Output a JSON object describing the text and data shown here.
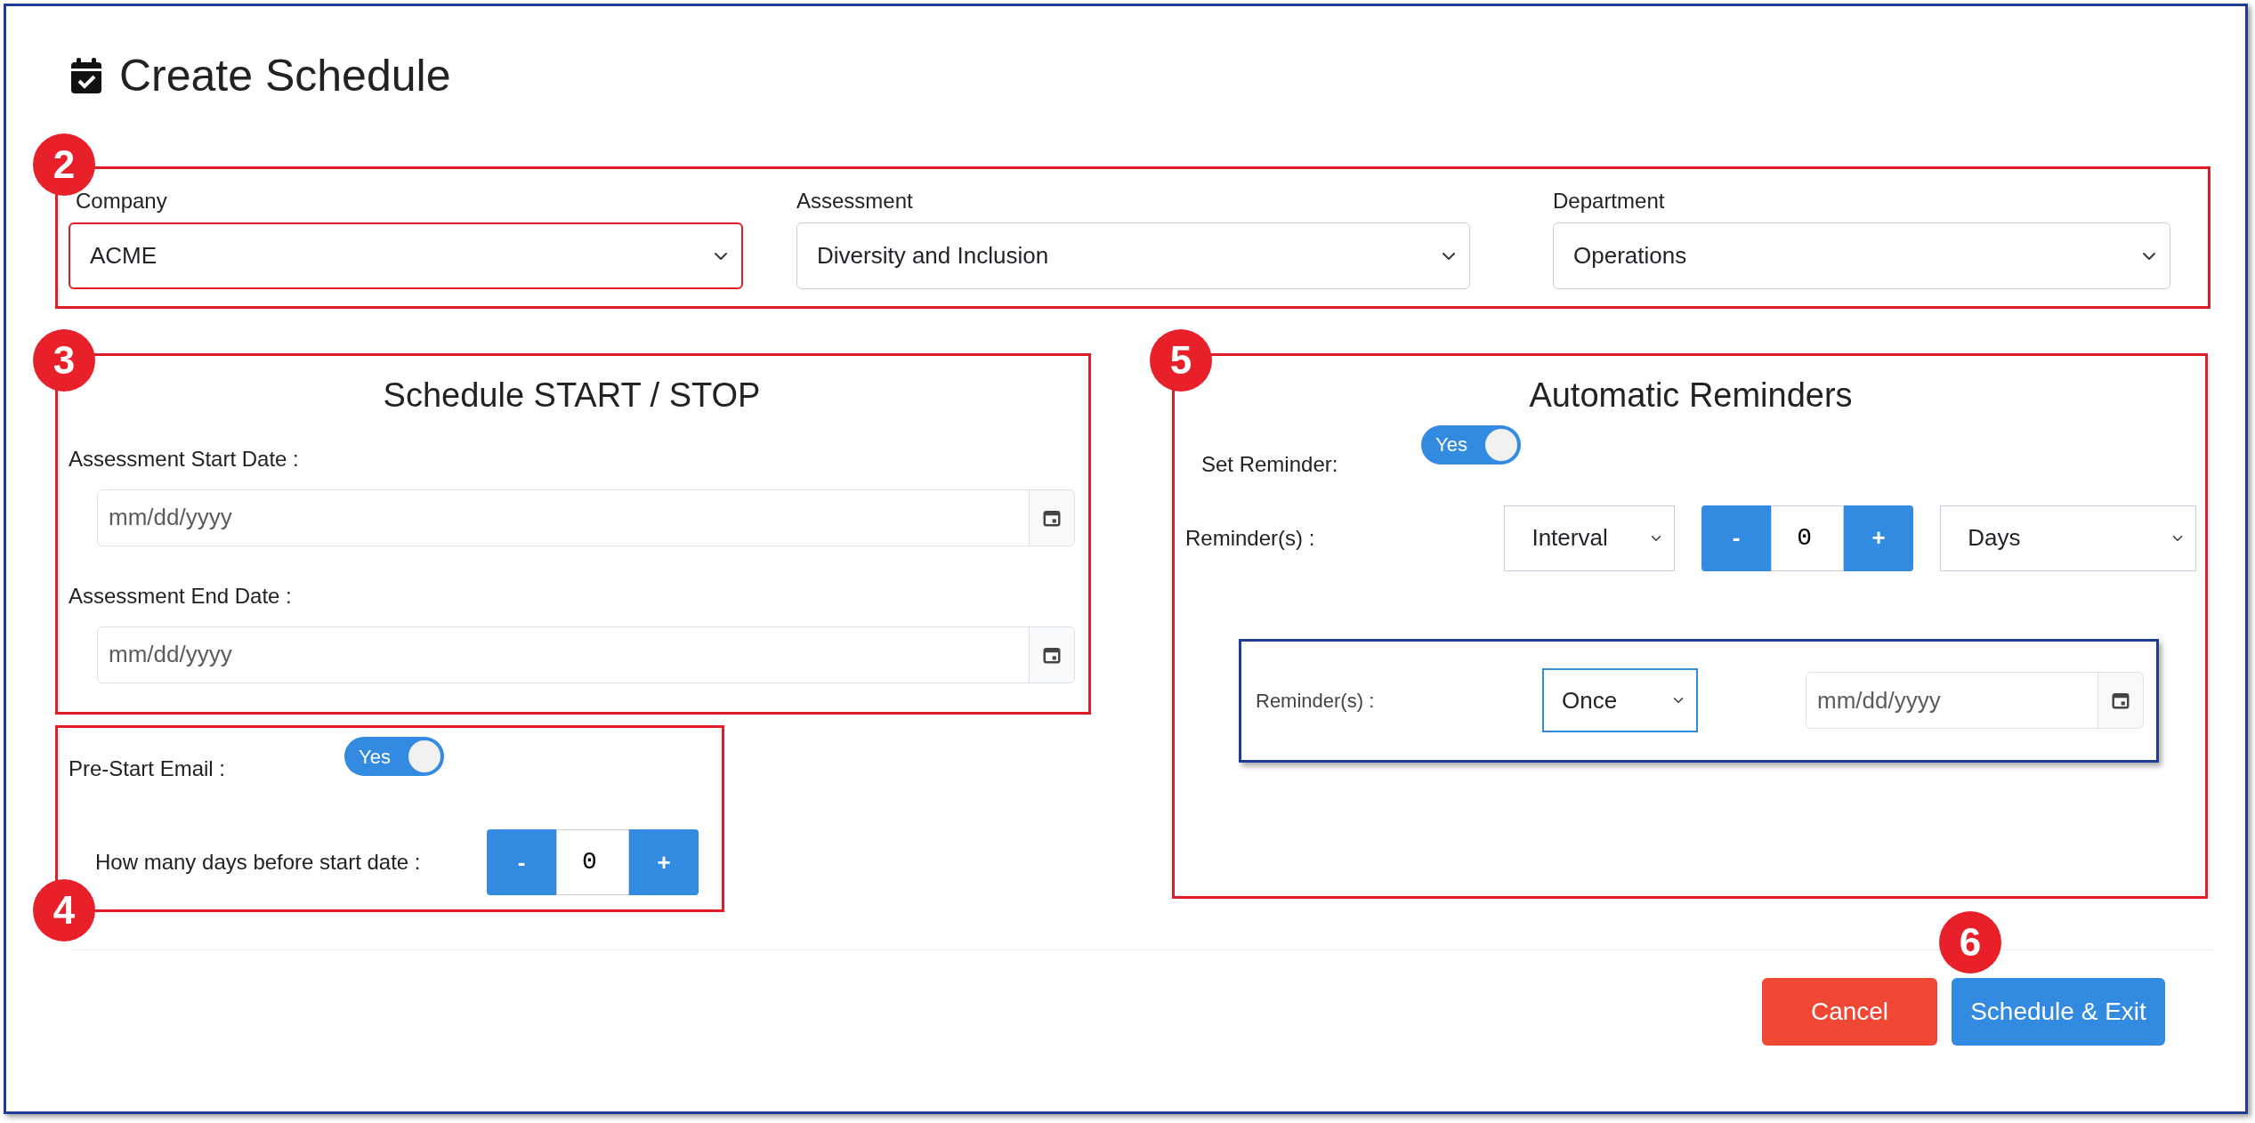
{
  "title": "Create Schedule",
  "filters": {
    "callout": "2",
    "fields": [
      {
        "label": "Company",
        "value": "ACME",
        "invalid": true
      },
      {
        "label": "Assessment",
        "value": "Diversity and Inclusion",
        "invalid": false
      },
      {
        "label": "Department",
        "value": "Operations",
        "invalid": false
      }
    ]
  },
  "schedule": {
    "callout": "3",
    "heading": "Schedule START / STOP",
    "dates": [
      {
        "label": "Assessment Start Date :",
        "placeholder": "mm/dd/yyyy"
      },
      {
        "label": "Assessment End Date :",
        "placeholder": "mm/dd/yyyy"
      }
    ]
  },
  "pre_start": {
    "callout": "4",
    "label": "Pre-Start Email :",
    "toggle": {
      "on": true,
      "text": "Yes"
    },
    "days_label": "How many days before start date :",
    "stepper": {
      "minus": "-",
      "value": "0",
      "plus": "+"
    }
  },
  "reminders": {
    "callout": "5",
    "heading": "Automatic Reminders",
    "set_label": "Set Reminder:",
    "toggle": {
      "on": true,
      "text": "Yes"
    },
    "row": {
      "label": "Reminder(s) :",
      "mode": "Interval",
      "stepper": {
        "minus": "-",
        "value": "0",
        "plus": "+"
      },
      "unit": "Days"
    },
    "inset": {
      "label": "Reminder(s) :",
      "mode": "Once",
      "placeholder": "mm/dd/yyyy"
    }
  },
  "actions": {
    "callout": "6",
    "buttons": [
      {
        "label": "Cancel",
        "kind": "danger"
      },
      {
        "label": "Schedule & Exit",
        "kind": "primary"
      }
    ]
  }
}
